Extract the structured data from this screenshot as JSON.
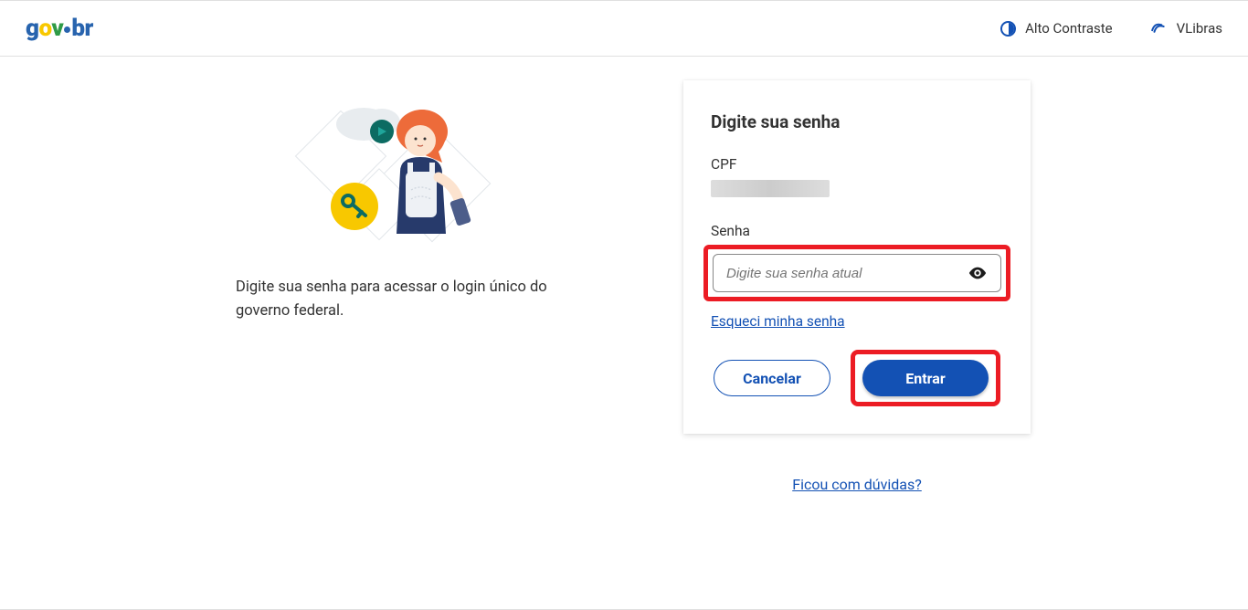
{
  "header": {
    "logo": "gov.br",
    "contrast_label": "Alto Contraste",
    "vlibras_label": "VLibras"
  },
  "left": {
    "caption": "Digite sua senha para acessar o login único do governo federal."
  },
  "card": {
    "title": "Digite sua senha",
    "cpf_label": "CPF",
    "cpf_value": "",
    "senha_label": "Senha",
    "senha_placeholder": "Digite sua senha atual",
    "forgot_label": "Esqueci minha senha",
    "cancel_label": "Cancelar",
    "enter_label": "Entrar"
  },
  "help": {
    "label": "Ficou com dúvidas?"
  },
  "colors": {
    "primary": "#1351b4",
    "highlight": "#ec1c24"
  }
}
